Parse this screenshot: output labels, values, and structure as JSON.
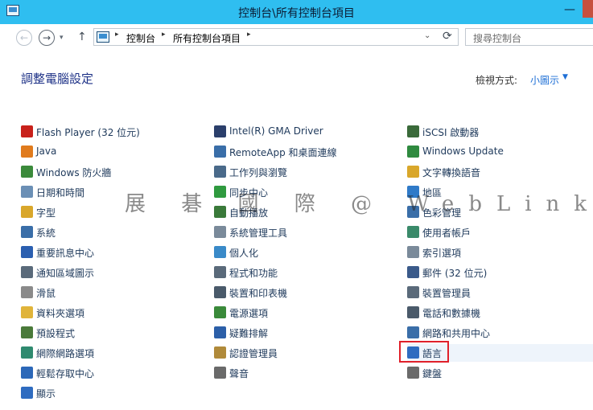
{
  "window": {
    "title": "控制台\\所有控制台項目",
    "min_glyph": "—"
  },
  "nav": {
    "back_glyph": "←",
    "forward_glyph": "→",
    "recent_glyph": "▾",
    "up_glyph": "↑",
    "refresh_glyph": "⟳",
    "dropdown_glyph": "⌄",
    "sep_glyph": "▸"
  },
  "breadcrumb": [
    "控制台",
    "所有控制台項目"
  ],
  "search": {
    "placeholder": "搜尋控制台"
  },
  "page": {
    "heading": "調整電腦設定",
    "view_by_label": "檢視方式:",
    "view_by_value": "小圖示",
    "view_by_arrow": "▼"
  },
  "watermark": "展 碁 國 際 @ WebLink",
  "items": {
    "col1": [
      {
        "label": "Flash Player (32 位元)",
        "icon": "flash-icon",
        "color": "#c8211b"
      },
      {
        "label": "Java",
        "icon": "java-icon",
        "color": "#e07b1d"
      },
      {
        "label": "Windows 防火牆",
        "icon": "firewall-icon",
        "color": "#3b8a3b"
      },
      {
        "label": "日期和時間",
        "icon": "calendar-icon",
        "color": "#6b8fb5"
      },
      {
        "label": "字型",
        "icon": "font-icon",
        "color": "#d9a72b"
      },
      {
        "label": "系統",
        "icon": "system-icon",
        "color": "#3a6ea8"
      },
      {
        "label": "重要訊息中心",
        "icon": "flag-icon",
        "color": "#2b5fb0"
      },
      {
        "label": "通知區域圖示",
        "icon": "notification-icon",
        "color": "#5a6a7a"
      },
      {
        "label": "滑鼠",
        "icon": "mouse-icon",
        "color": "#8a8a8a"
      },
      {
        "label": "資料夾選項",
        "icon": "folder-icon",
        "color": "#e0b43a"
      },
      {
        "label": "預設程式",
        "icon": "default-programs-icon",
        "color": "#4a7a3a"
      },
      {
        "label": "網際網路選項",
        "icon": "internet-options-icon",
        "color": "#2f8a6f"
      },
      {
        "label": "輕鬆存取中心",
        "icon": "ease-of-access-icon",
        "color": "#2c68b8"
      },
      {
        "label": "顯示",
        "icon": "display-icon",
        "color": "#2f6cc0"
      }
    ],
    "col2": [
      {
        "label": "Intel(R) GMA Driver",
        "icon": "intel-icon",
        "color": "#2b3f6b"
      },
      {
        "label": "RemoteApp 和桌面連線",
        "icon": "remoteapp-icon",
        "color": "#3a6ea8"
      },
      {
        "label": "工作列與瀏覽",
        "icon": "taskbar-icon",
        "color": "#4a6a8a"
      },
      {
        "label": "同步中心",
        "icon": "sync-icon",
        "color": "#2f9a3f"
      },
      {
        "label": "自動播放",
        "icon": "autoplay-icon",
        "color": "#3a7a3a"
      },
      {
        "label": "系統管理工具",
        "icon": "admin-tools-icon",
        "color": "#7a8a9a"
      },
      {
        "label": "個人化",
        "icon": "personalization-icon",
        "color": "#3a8ac8"
      },
      {
        "label": "程式和功能",
        "icon": "programs-icon",
        "color": "#5a6a7a"
      },
      {
        "label": "裝置和印表機",
        "icon": "printer-icon",
        "color": "#4a5a6a"
      },
      {
        "label": "電源選項",
        "icon": "power-icon",
        "color": "#3a8a3a"
      },
      {
        "label": "疑難排解",
        "icon": "troubleshoot-icon",
        "color": "#2c5fa8"
      },
      {
        "label": "認證管理員",
        "icon": "credential-icon",
        "color": "#b08a3a"
      },
      {
        "label": "聲音",
        "icon": "sound-icon",
        "color": "#6a6a6a"
      }
    ],
    "col3": [
      {
        "label": "iSCSI 啟動器",
        "icon": "iscsi-icon",
        "color": "#3a6a3a"
      },
      {
        "label": "Windows Update",
        "icon": "windows-update-icon",
        "color": "#2f8a3f"
      },
      {
        "label": "文字轉換語音",
        "icon": "text-to-speech-icon",
        "color": "#d9a72b"
      },
      {
        "label": "地區",
        "icon": "region-icon",
        "color": "#2f7ac8"
      },
      {
        "label": "色彩管理",
        "icon": "color-management-icon",
        "color": "#3a6ea8"
      },
      {
        "label": "使用者帳戶",
        "icon": "user-accounts-icon",
        "color": "#3a8a6a"
      },
      {
        "label": "索引選項",
        "icon": "indexing-icon",
        "color": "#7a8a9a"
      },
      {
        "label": "郵件 (32 位元)",
        "icon": "mail-icon",
        "color": "#3a5a8a"
      },
      {
        "label": "裝置管理員",
        "icon": "device-manager-icon",
        "color": "#5a6a7a"
      },
      {
        "label": "電話和數據機",
        "icon": "phone-modem-icon",
        "color": "#4a5a6a"
      },
      {
        "label": "網路和共用中心",
        "icon": "network-icon",
        "color": "#3a6ea8"
      },
      {
        "label": "語言",
        "icon": "language-icon",
        "color": "#2f6cc0"
      },
      {
        "label": "鍵盤",
        "icon": "keyboard-icon",
        "color": "#6a6a6a"
      }
    ]
  }
}
